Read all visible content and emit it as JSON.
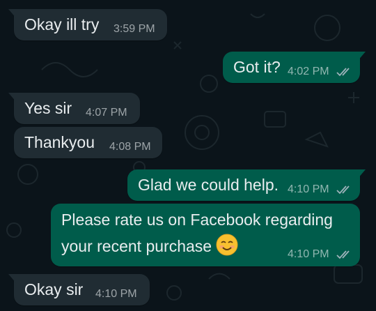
{
  "chat": {
    "messages": [
      {
        "direction": "incoming",
        "text": "Okay ill try",
        "time": "3:59 PM"
      },
      {
        "direction": "outgoing",
        "text": "Got it?",
        "time": "4:02 PM",
        "status": "read-ticks-icon"
      },
      {
        "direction": "incoming",
        "text": "Yes sir",
        "time": "4:07 PM"
      },
      {
        "direction": "incoming",
        "text": "Thankyou",
        "time": "4:08 PM"
      },
      {
        "direction": "outgoing",
        "text": "Glad we could help.",
        "time": "4:10 PM",
        "status": "read-ticks-icon"
      },
      {
        "direction": "outgoing",
        "line1": "Please rate us on Facebook regarding",
        "line2": "your recent purchase",
        "emoji": "smiling-face-emoji-icon",
        "time": "4:10 PM",
        "status": "read-ticks-icon"
      },
      {
        "direction": "incoming",
        "text": "Okay sir",
        "time": "4:10 PM"
      }
    ]
  },
  "colors": {
    "background": "#0b141a",
    "incoming_bubble": "#202c33",
    "outgoing_bubble": "#005c4b",
    "text": "#e9edef",
    "tick": "#9fb3bb"
  }
}
